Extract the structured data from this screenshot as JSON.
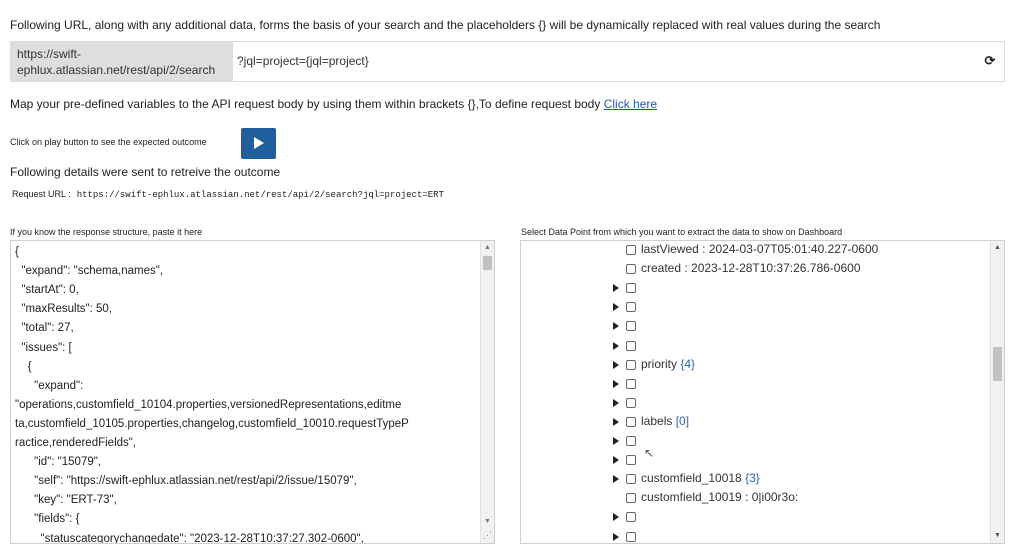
{
  "intro_text": "Following URL, along with any additional data, forms the basis of your search and the placeholders {} will be dynamically replaced with real values during the search",
  "url": {
    "base": "https://swift-ephlux.atlassian.net/rest/api/2/search",
    "suffix": "?jql=project={jql=project}"
  },
  "map_text": "Map your pre-defined variables to the API request body by using them within brackets {},To define request body",
  "map_link": "Click here",
  "play_label": "Click on play button to see the expected outcome",
  "following_text": "Following details were sent to retreive the outcome",
  "request": {
    "label": "Request URL :",
    "url": "https://swift-ephlux.atlassian.net/rest/api/2/search?jql=project=ERT"
  },
  "left_label": "If you know the response structure, paste it here",
  "right_label": "Select Data Point from which you want to extract the data to show on Dashboard",
  "code_lines": [
    "{",
    "  \"expand\": \"schema,names\",",
    "  \"startAt\": 0,",
    "  \"maxResults\": 50,",
    "  \"total\": 27,",
    "  \"issues\": [",
    "    {",
    "      \"expand\":",
    "\"operations,customfield_10104.properties,versionedRepresentations,editme",
    "ta,customfield_10105.properties,changelog,customfield_10010.requestTypeP",
    "ractice,renderedFields\",",
    "      \"id\": \"15079\",",
    "      \"self\": \"https://swift-ephlux.atlassian.net/rest/api/2/issue/15079\",",
    "      \"key\": \"ERT-73\",",
    "      \"fields\": {",
    "        \"statuscategorychangedate\": \"2023-12-28T10:37:27.302-0600\","
  ],
  "tree_rows": [
    {
      "arrow": false,
      "label": "lastViewed : 2024-03-07T05:01:40.227-0600",
      "count": ""
    },
    {
      "arrow": false,
      "label": "created : 2023-12-28T10:37:26.786-0600",
      "count": ""
    },
    {
      "arrow": true,
      "label": "",
      "count": ""
    },
    {
      "arrow": true,
      "label": "",
      "count": ""
    },
    {
      "arrow": true,
      "label": "",
      "count": ""
    },
    {
      "arrow": true,
      "label": "",
      "count": ""
    },
    {
      "arrow": true,
      "label": "priority ",
      "count": "{4}"
    },
    {
      "arrow": true,
      "label": "",
      "count": ""
    },
    {
      "arrow": true,
      "label": "",
      "count": ""
    },
    {
      "arrow": true,
      "label": "labels ",
      "count": "[0]"
    },
    {
      "arrow": true,
      "label": "",
      "count": ""
    },
    {
      "arrow": true,
      "label": "",
      "count": ""
    },
    {
      "arrow": true,
      "label": "customfield_10018 ",
      "count": "{3}"
    },
    {
      "arrow": false,
      "label": "customfield_10019 : 0|i00r3o:",
      "count": ""
    },
    {
      "arrow": true,
      "label": "",
      "count": ""
    },
    {
      "arrow": true,
      "label": "",
      "count": ""
    }
  ]
}
